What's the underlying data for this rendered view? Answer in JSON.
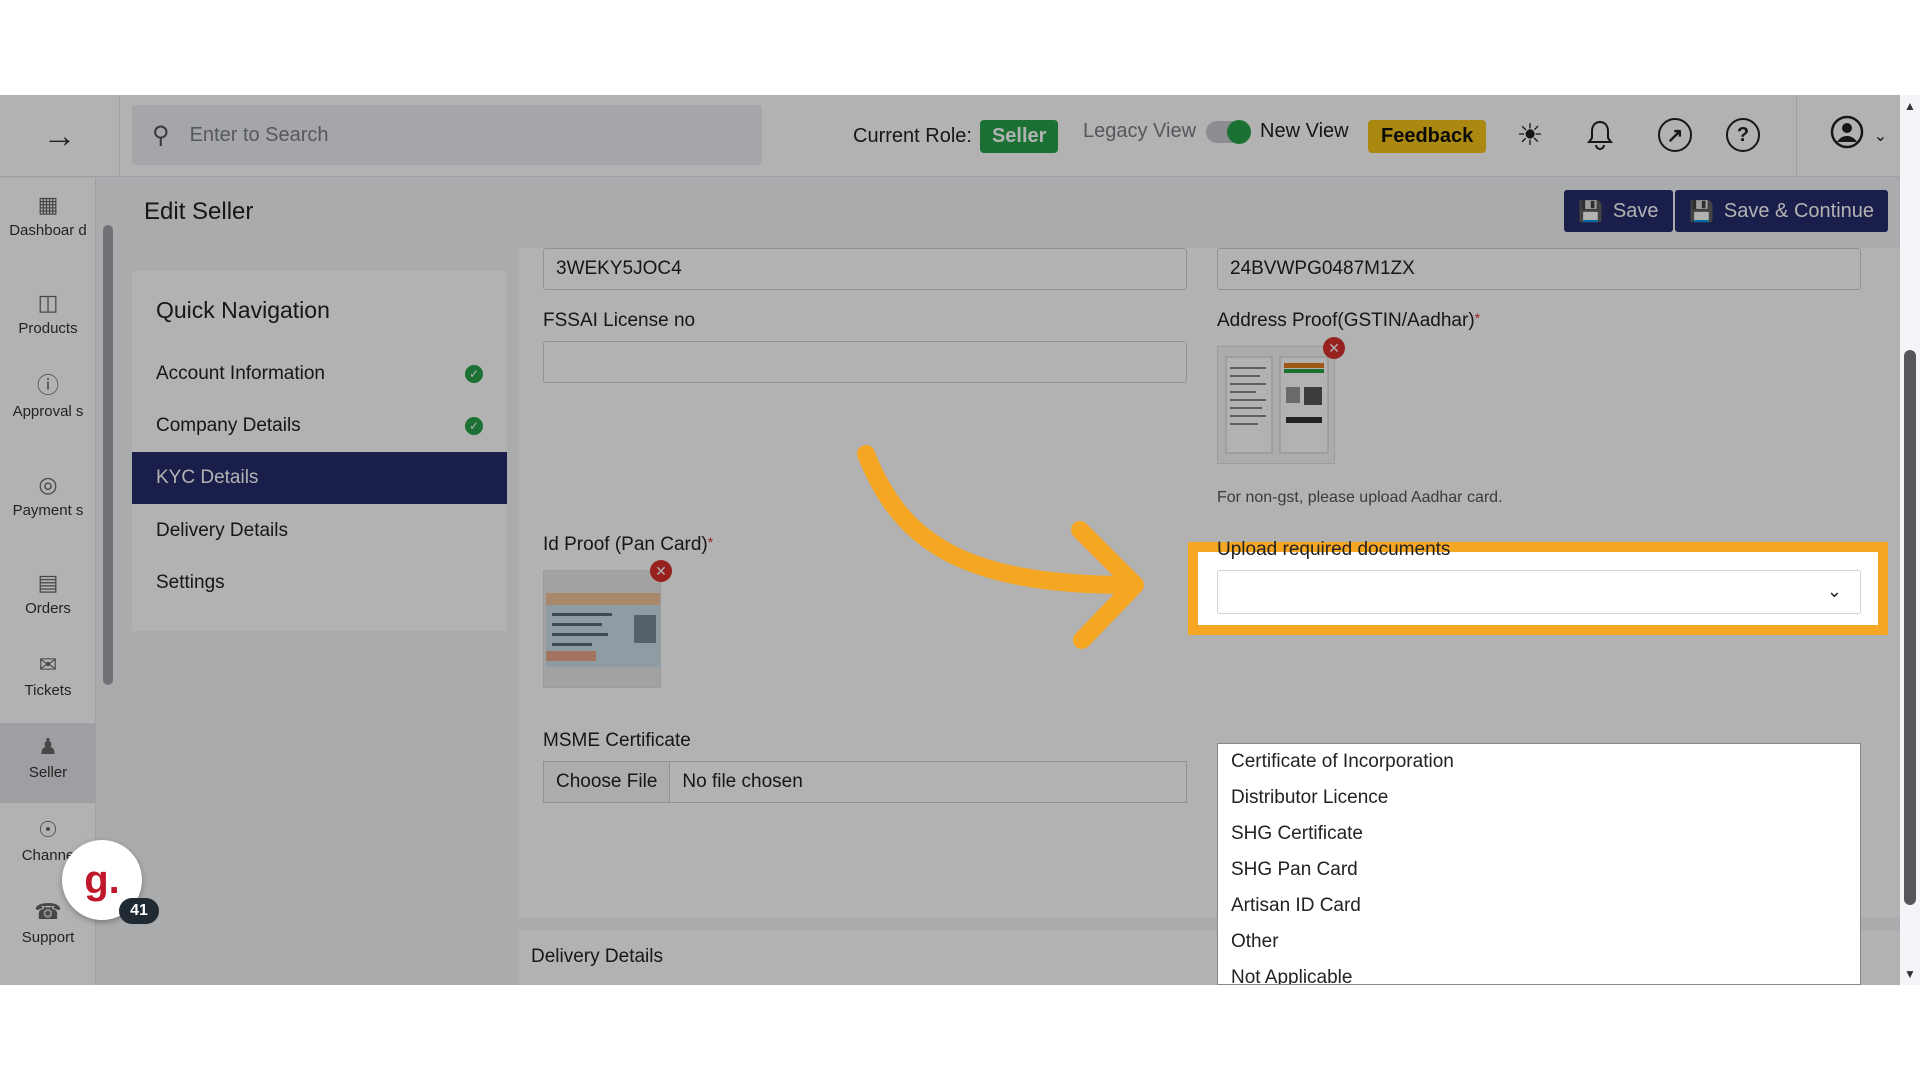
{
  "topbar": {
    "search_placeholder": "Enter to Search",
    "current_role_label": "Current Role:",
    "current_role_value": "Seller",
    "legacy_view_label": "Legacy View",
    "new_view_label": "New View",
    "feedback_label": "Feedback",
    "icons": [
      "arrow-right-icon",
      "search-icon",
      "sun-icon",
      "bell-icon",
      "external-link-icon",
      "help-icon",
      "user-icon",
      "chevron-down-icon"
    ]
  },
  "sidebar": {
    "items": [
      {
        "label": "Dashboar d",
        "icon": "grid-icon"
      },
      {
        "label": "Products",
        "icon": "box-icon"
      },
      {
        "label": "Approval s",
        "icon": "approval-icon"
      },
      {
        "label": "Payment s",
        "icon": "payment-icon"
      },
      {
        "label": "Orders",
        "icon": "orders-icon"
      },
      {
        "label": "Tickets",
        "icon": "tickets-icon"
      },
      {
        "label": "Seller",
        "icon": "seller-icon"
      },
      {
        "label": "Channe",
        "icon": "channel-icon"
      },
      {
        "label": "Support",
        "icon": "headset-icon"
      }
    ],
    "active": "Seller"
  },
  "header": {
    "title": "Edit Seller",
    "save_label": "Save",
    "save_continue_label": "Save & Continue"
  },
  "quick_nav": {
    "title": "Quick Navigation",
    "items": [
      {
        "label": "Account Information",
        "done": true
      },
      {
        "label": "Company Details",
        "done": true
      },
      {
        "label": "KYC Details",
        "done": false,
        "active": true
      },
      {
        "label": "Delivery Details",
        "done": false
      },
      {
        "label": "Settings",
        "done": false
      }
    ]
  },
  "form": {
    "top_left_value": "3WEKY5JOC4",
    "top_right_value": "24BVWPG0487M1ZX",
    "fssai_label": "FSSAI License no",
    "fssai_value": "",
    "address_proof_label": "Address Proof(GSTIN/Aadhar)",
    "address_hint": "For non-gst, please upload Aadhar card.",
    "id_proof_label": "Id Proof (Pan Card)",
    "upload_label": "Upload required documents",
    "msme_label": "MSME Certificate",
    "choose_file": "Choose File",
    "no_file": "No file chosen",
    "required_mark": "*"
  },
  "dropdown": {
    "options": [
      "Certificate of Incorporation",
      "Distributor Licence",
      "SHG Certificate",
      "SHG Pan Card",
      "Artisan ID Card",
      "Other",
      "Not Applicable"
    ]
  },
  "section2": {
    "title": "Delivery Details"
  },
  "badge": {
    "letter": "g.",
    "count": "41"
  },
  "colors": {
    "primary": "#242b6b",
    "success": "#27a249",
    "feedback": "#f5c518",
    "highlight": "#f5a623"
  }
}
